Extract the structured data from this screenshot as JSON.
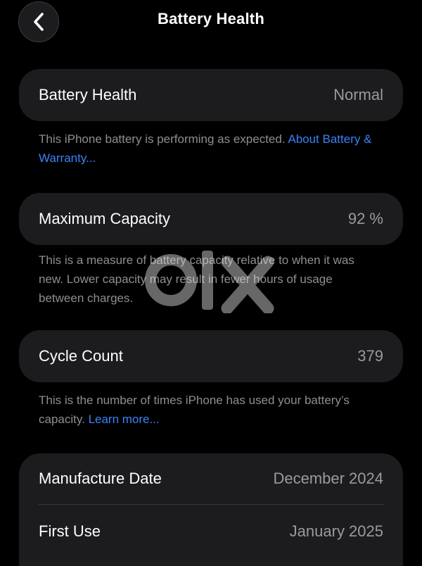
{
  "nav": {
    "title": "Battery Health",
    "back_icon": "chevron-left-icon"
  },
  "battery_health": {
    "label": "Battery Health",
    "value": "Normal",
    "footnote": "This iPhone battery is performing as expected. ",
    "link": "About Battery & Warranty..."
  },
  "maximum_capacity": {
    "label": "Maximum Capacity",
    "value": "92 %",
    "footnote": "This is a measure of battery capacity relative to when it was new. Lower capacity may result in fewer hours of usage between charges."
  },
  "cycle_count": {
    "label": "Cycle Count",
    "value": "379",
    "footnote": "This is the number of times iPhone has used your battery’s capacity. ",
    "link": "Learn more..."
  },
  "dates": {
    "manufacture_label": "Manufacture Date",
    "manufacture_value": "December 2024",
    "first_use_label": "First Use",
    "first_use_value": "January 2025"
  },
  "watermark": {
    "text": "olx"
  },
  "colors": {
    "background": "#000000",
    "card": "#1c1c1e",
    "secondary_text": "#9a9a9f",
    "link": "#3b82f6"
  }
}
